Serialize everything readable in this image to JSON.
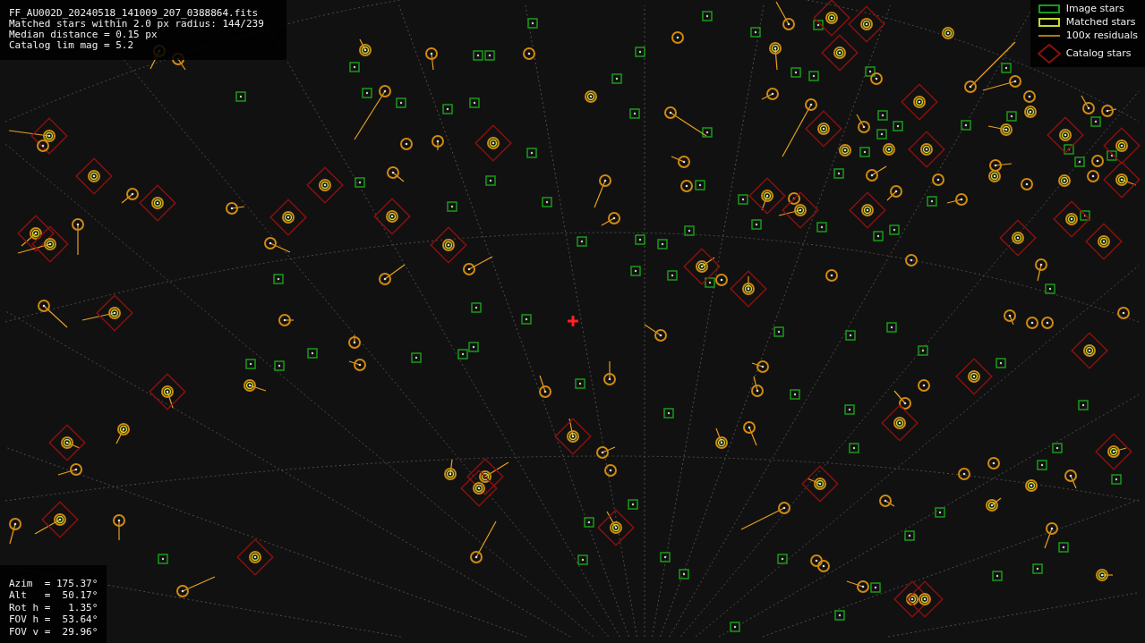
{
  "file_info": {
    "lines": [
      "FF_AU002D_20240518_141009_207_0388864.fits",
      "Matched stars within 2.0 px radius: 144/239",
      "Median distance = 0.15 px",
      "Catalog lim mag = 5.2"
    ]
  },
  "legend": {
    "items": [
      {
        "kind": "image",
        "label": "Image stars"
      },
      {
        "kind": "matched",
        "label": "Matched stars"
      },
      {
        "kind": "residual",
        "label": "100x residuals"
      },
      {
        "kind": "catalog",
        "label": "Catalog stars"
      }
    ]
  },
  "pointing": {
    "lines": [
      "Azim  = 175.37°",
      "Alt   =  50.17°",
      "Rot h =   1.35°",
      "FOV h =  53.64°",
      "FOV v =  29.96°"
    ]
  }
}
